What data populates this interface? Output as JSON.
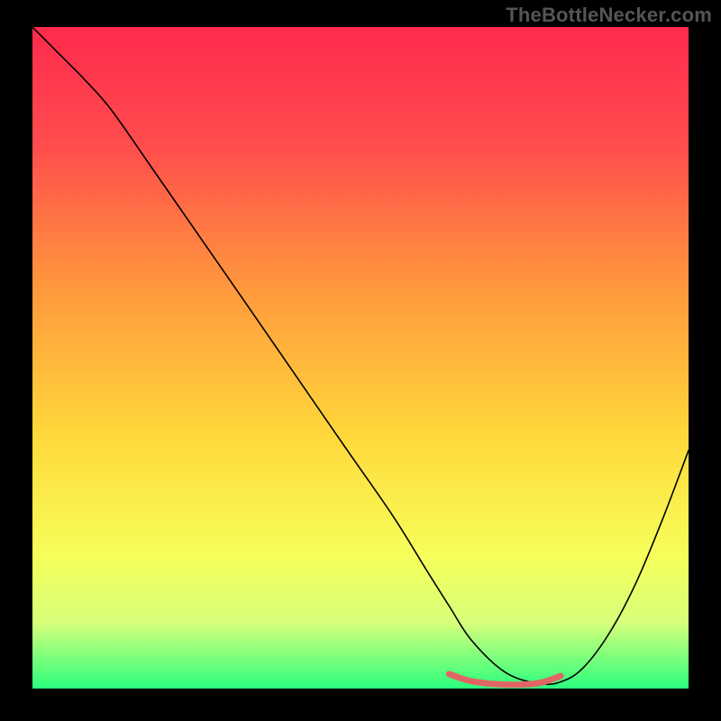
{
  "watermark": "TheBottleNecker.com",
  "chart_data": {
    "type": "line",
    "title": "",
    "xlabel": "",
    "ylabel": "",
    "xlim": [
      0,
      100
    ],
    "ylim": [
      0,
      100
    ],
    "grid": false,
    "background_gradient": {
      "stops": [
        {
          "offset": 0,
          "color": "#ff2a4d"
        },
        {
          "offset": 18,
          "color": "#ff4d4d"
        },
        {
          "offset": 40,
          "color": "#ff9a3c"
        },
        {
          "offset": 62,
          "color": "#ffd93b"
        },
        {
          "offset": 80,
          "color": "#f6ff5a"
        },
        {
          "offset": 90,
          "color": "#d7ff7a"
        },
        {
          "offset": 100,
          "color": "#2bff7e"
        }
      ]
    },
    "series": [
      {
        "name": "bottleneck-curve",
        "color": "#000000",
        "width": 1.6,
        "x": [
          0,
          4,
          8,
          12,
          18,
          25,
          32,
          40,
          48,
          55,
          60,
          63.5,
          67,
          72,
          77,
          80.5,
          84,
          88,
          92,
          96,
          100
        ],
        "y": [
          100,
          96,
          92,
          87.5,
          79,
          69,
          59,
          47.5,
          36,
          26,
          18,
          12.5,
          7.2,
          2.5,
          0.8,
          1.0,
          3.2,
          8.5,
          16,
          25.5,
          36
        ]
      },
      {
        "name": "target-band",
        "color": "#e06666",
        "width": 7,
        "cap": "round",
        "x": [
          63.5,
          67,
          72,
          77,
          80.5
        ],
        "y": [
          2.2,
          1.1,
          0.6,
          0.8,
          1.9
        ]
      }
    ]
  }
}
